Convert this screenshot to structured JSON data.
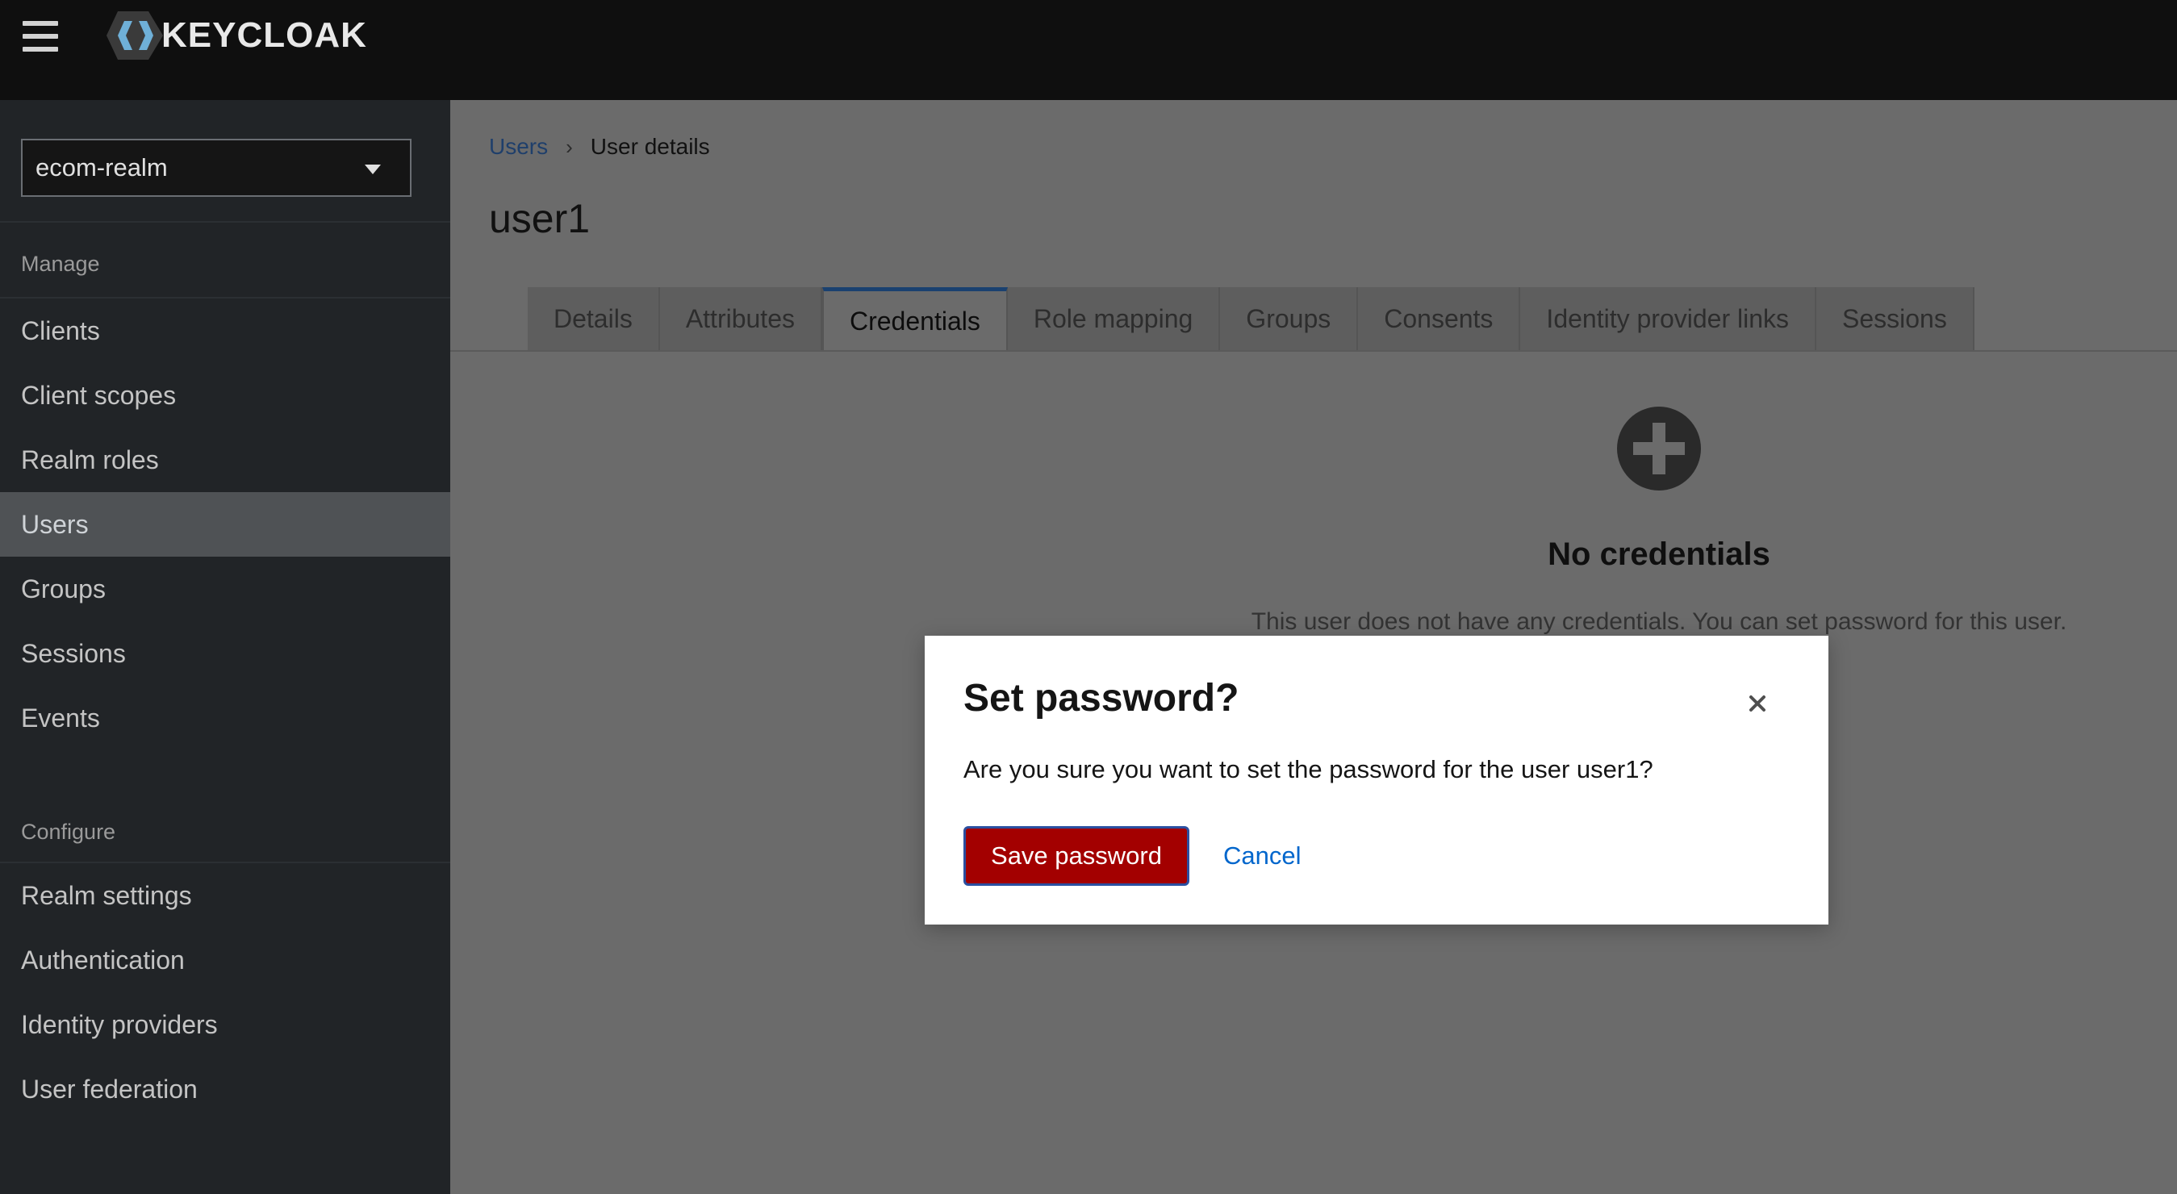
{
  "brand": {
    "name": "KEYCLOAK"
  },
  "icons": {
    "menu": "hamburger-menu-icon",
    "realm_caret": "caret-down-icon",
    "breadcrumb_sep": "chevron-right-icon",
    "empty": "plus-circle-icon",
    "close": "close-icon"
  },
  "sidebar": {
    "realm": "ecom-realm",
    "manage_title": "Manage",
    "manage_items": [
      {
        "label": "Clients"
      },
      {
        "label": "Client scopes"
      },
      {
        "label": "Realm roles"
      },
      {
        "label": "Users",
        "active": true
      },
      {
        "label": "Groups"
      },
      {
        "label": "Sessions"
      },
      {
        "label": "Events"
      }
    ],
    "configure_title": "Configure",
    "configure_items": [
      {
        "label": "Realm settings"
      },
      {
        "label": "Authentication"
      },
      {
        "label": "Identity providers"
      },
      {
        "label": "User federation"
      }
    ]
  },
  "breadcrumb": {
    "parent": "Users",
    "separator": "›",
    "current": "User details"
  },
  "page": {
    "title": "user1"
  },
  "tabs": [
    {
      "label": "Details"
    },
    {
      "label": "Attributes"
    },
    {
      "label": "Credentials",
      "active": true
    },
    {
      "label": "Role mapping"
    },
    {
      "label": "Groups"
    },
    {
      "label": "Consents"
    },
    {
      "label": "Identity provider links"
    },
    {
      "label": "Sessions"
    }
  ],
  "empty_state": {
    "title": "No credentials",
    "body": "This user does not have any credentials. You can set password for this user."
  },
  "modal": {
    "title": "Set password?",
    "body": "Are you sure you want to set the password for the user user1?",
    "confirm_label": "Save password",
    "cancel_label": "Cancel"
  },
  "colors": {
    "masthead": "#0f0f0f",
    "sidebar": "#212427",
    "overlay_main": "#6b6b6b",
    "danger": "#a30000",
    "link": "#0066cc",
    "active_tab_border": "#1a4170"
  }
}
